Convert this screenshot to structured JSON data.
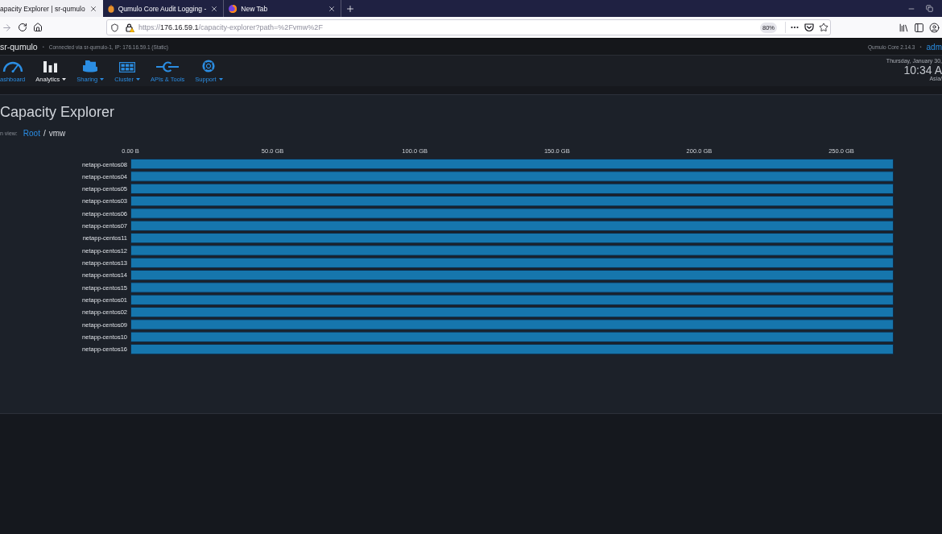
{
  "browser": {
    "tabs": [
      {
        "title": "apacity Explorer | sr-qumulo",
        "selected": true
      },
      {
        "title": "Qumulo Core Audit Logging -",
        "selected": false
      },
      {
        "title": "New Tab",
        "selected": false
      }
    ],
    "address_bar": {
      "url_prefix": "https://",
      "url_host": "176.16.59.1",
      "url_path": "/capacity-explorer?path=%2Fvmw%2F",
      "zoom": "80%"
    }
  },
  "header": {
    "cluster_name": "sr-qumulo",
    "connection_separator": "•",
    "connection": "Connected via sr-qumulo-1, IP: 176.16.59.1 (Static)",
    "version": "Qumulo Core 2.14.3",
    "user_separator": "•",
    "user": "adm"
  },
  "nav": {
    "items": [
      {
        "label": "ashboard",
        "selected": false,
        "has_menu": false
      },
      {
        "label": "Analytics",
        "selected": true,
        "has_menu": true
      },
      {
        "label": "Sharing",
        "selected": false,
        "has_menu": true
      },
      {
        "label": "Cluster",
        "selected": false,
        "has_menu": true
      },
      {
        "label": "APIs & Tools",
        "selected": false,
        "has_menu": false
      },
      {
        "label": "Support",
        "selected": false,
        "has_menu": true
      }
    ]
  },
  "clock": {
    "date": "Thursday, January 30,",
    "time": "10:34 A",
    "timezone": "Asia/"
  },
  "page": {
    "title": "Capacity Explorer",
    "breadcrumb_label": "n view:",
    "breadcrumb": [
      {
        "label": "Root",
        "link": true
      },
      {
        "label": "vmw",
        "link": false
      }
    ],
    "breadcrumb_separator": "/",
    "chart_data": {
      "type": "bar",
      "orientation": "horizontal",
      "categories": [
        "netapp-centos08",
        "netapp-centos04",
        "netapp-centos05",
        "netapp-centos03",
        "netapp-centos06",
        "netapp-centos07",
        "netapp-centos11",
        "netapp-centos12",
        "netapp-centos13",
        "netapp-centos14",
        "netapp-centos15",
        "netapp-centos01",
        "netapp-centos02",
        "netapp-centos09",
        "netapp-centos10",
        "netapp-centos16"
      ],
      "values": [
        268.4,
        268.4,
        268.4,
        268.4,
        268.4,
        268.4,
        268.4,
        268.4,
        268.4,
        268.4,
        268.4,
        268.4,
        268.4,
        268.4,
        268.4,
        268.4
      ],
      "xlim": [
        0,
        268.4
      ],
      "xticks": [
        {
          "value": 0,
          "label": "0.00 B"
        },
        {
          "value": 50,
          "label": "50.0 GB"
        },
        {
          "value": 100,
          "label": "100.0 GB"
        },
        {
          "value": 150,
          "label": "150.0 GB"
        },
        {
          "value": 200,
          "label": "200.0 GB"
        },
        {
          "value": 250,
          "label": "250.0 GB"
        }
      ]
    }
  }
}
